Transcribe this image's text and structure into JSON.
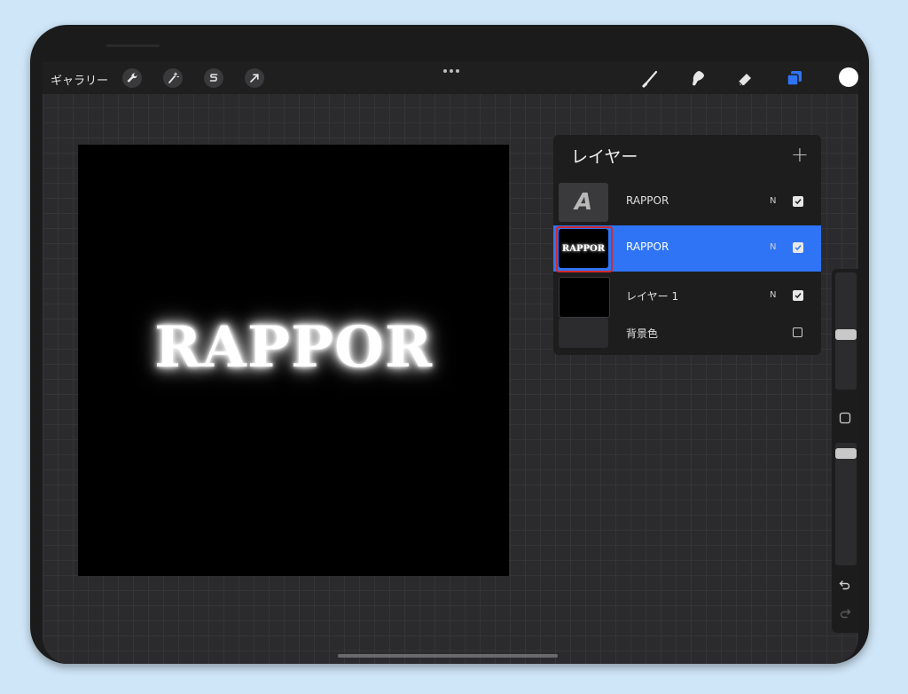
{
  "toolbar": {
    "gallery_label": "ギャラリー",
    "left_tools": [
      "wrench-icon",
      "magic-wand-icon",
      "selection-icon",
      "transform-arrow-icon"
    ],
    "right_tools": [
      "brush-icon",
      "smudge-icon",
      "eraser-icon",
      "layers-icon"
    ],
    "active_tool": "layers-icon",
    "accent": "#2f74f5",
    "color_swatch": "#ffffff"
  },
  "canvas": {
    "text": "RAPPOR",
    "background": "#000000"
  },
  "layers_panel": {
    "title": "レイヤー",
    "add_label": "+",
    "layers": [
      {
        "name": "RAPPOR",
        "blend": "N",
        "visible": true,
        "thumb": "A",
        "selected": false
      },
      {
        "name": "RAPPOR",
        "blend": "N",
        "visible": true,
        "thumb": "RAPPOR",
        "selected": true
      },
      {
        "name": "レイヤー 1",
        "blend": "N",
        "visible": true,
        "thumb": "",
        "selected": false
      },
      {
        "name": "背景色",
        "blend": "",
        "visible": false,
        "thumb": "",
        "selected": false
      }
    ]
  }
}
